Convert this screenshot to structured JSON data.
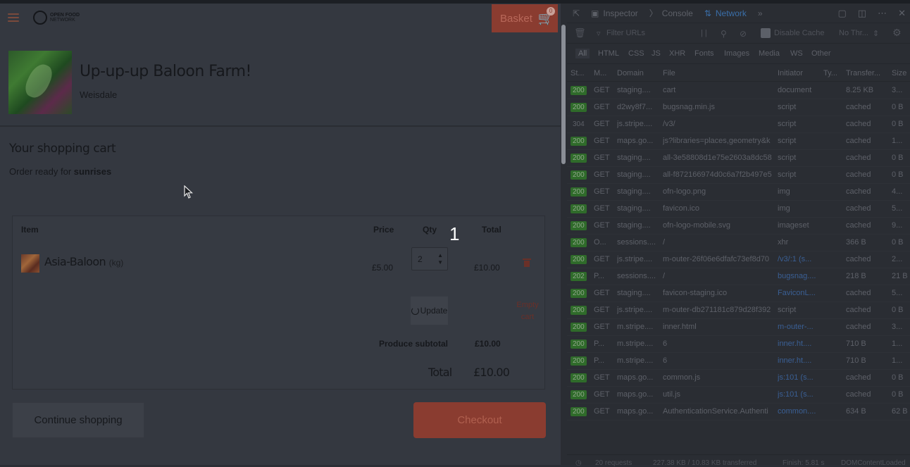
{
  "page": {
    "logo_top": "OPEN FOOD",
    "logo_bottom": "NETWORK",
    "basket_label": "Basket",
    "basket_count": "0",
    "farm_name": "Up-up-up Baloon Farm!",
    "farm_location": "Weisdale",
    "cart_title": "Your shopping cart",
    "order_prefix": "Order ready for ",
    "order_window": "sunrises",
    "table": {
      "headers": {
        "item": "Item",
        "price": "Price",
        "qty": "Qty",
        "total": "Total"
      },
      "row": {
        "name": "Asia-Baloon",
        "unit": "(kg)",
        "price": "£5.00",
        "qty": "2",
        "total": "£10.00"
      }
    },
    "update_label": "Update",
    "empty_cart_label": "Empty cart",
    "produce_subtotal_label": "Produce subtotal",
    "produce_subtotal_value": "£10.00",
    "total_label": "Total",
    "total_value": "£10.00",
    "continue_label": "Continue shopping",
    "checkout_label": "Checkout",
    "overlay_number": "1"
  },
  "devtools": {
    "tabs": [
      "Inspector",
      "Console",
      "Network"
    ],
    "active_tab": "Network",
    "filter_placeholder": "Filter URLs",
    "disable_cache": "Disable Cache",
    "throttle": "No Thr...",
    "types": [
      "All",
      "HTML",
      "CSS",
      "JS",
      "XHR",
      "Fonts",
      "Images",
      "Media",
      "WS",
      "Other"
    ],
    "columns": [
      "St...",
      "M...",
      "Domain",
      "File",
      "Initiator",
      "Ty...",
      "Transfer...",
      "Size"
    ],
    "requests": [
      {
        "status": "200",
        "method": "GET",
        "domain": "staging....",
        "file": "cart",
        "initiator": "document",
        "initiator_link": false,
        "transferred": "8.25 KB",
        "size": "3..."
      },
      {
        "status": "200",
        "method": "GET",
        "domain": "d2wy8f7...",
        "file": "bugsnag.min.js",
        "initiator": "script",
        "initiator_link": false,
        "transferred": "cached",
        "size": "0 B"
      },
      {
        "status": "304",
        "method": "GET",
        "domain": "js.stripe....",
        "file": "/v3/",
        "initiator": "script",
        "initiator_link": false,
        "transferred": "cached",
        "size": "0 B"
      },
      {
        "status": "200",
        "method": "GET",
        "domain": "maps.go...",
        "file": "js?libraries=places,geometry&k",
        "initiator": "script",
        "initiator_link": false,
        "transferred": "cached",
        "size": "1..."
      },
      {
        "status": "200",
        "method": "GET",
        "domain": "staging....",
        "file": "all-3e58808d1e75e2603a8dc58",
        "initiator": "script",
        "initiator_link": false,
        "transferred": "cached",
        "size": "0 B"
      },
      {
        "status": "200",
        "method": "GET",
        "domain": "staging....",
        "file": "all-f872166974d0c6a7f2b497e5",
        "initiator": "script",
        "initiator_link": false,
        "transferred": "cached",
        "size": "0 B"
      },
      {
        "status": "200",
        "method": "GET",
        "domain": "staging....",
        "file": "ofn-logo.png",
        "initiator": "img",
        "initiator_link": false,
        "transferred": "cached",
        "size": "4..."
      },
      {
        "status": "200",
        "method": "GET",
        "domain": "staging....",
        "file": "favicon.ico",
        "initiator": "img",
        "initiator_link": false,
        "transferred": "cached",
        "size": "5..."
      },
      {
        "status": "200",
        "method": "GET",
        "domain": "staging....",
        "file": "ofn-logo-mobile.svg",
        "initiator": "imageset",
        "initiator_link": false,
        "transferred": "cached",
        "size": "9..."
      },
      {
        "status": "200",
        "method": "O...",
        "domain": "sessions....",
        "file": "/",
        "initiator": "xhr",
        "initiator_link": false,
        "transferred": "366 B",
        "size": "0 B"
      },
      {
        "status": "200",
        "method": "GET",
        "domain": "js.stripe....",
        "file": "m-outer-26f06e6dfafc73ef8d70",
        "initiator": "/v3/:1 (s...",
        "initiator_link": true,
        "transferred": "cached",
        "size": "2..."
      },
      {
        "status": "202",
        "method": "P...",
        "domain": "sessions....",
        "file": "/",
        "initiator": "bugsnag....",
        "initiator_link": true,
        "transferred": "218 B",
        "size": "21 B"
      },
      {
        "status": "200",
        "method": "GET",
        "domain": "staging....",
        "file": "favicon-staging.ico",
        "initiator": "FaviconL...",
        "initiator_link": true,
        "transferred": "cached",
        "size": "5..."
      },
      {
        "status": "200",
        "method": "GET",
        "domain": "js.stripe....",
        "file": "m-outer-db271181c879d28f392",
        "initiator": "script",
        "initiator_link": false,
        "transferred": "cached",
        "size": "0 B"
      },
      {
        "status": "200",
        "method": "GET",
        "domain": "m.stripe....",
        "file": "inner.html",
        "initiator": "m-outer-...",
        "initiator_link": true,
        "transferred": "cached",
        "size": "3..."
      },
      {
        "status": "200",
        "method": "P...",
        "domain": "m.stripe....",
        "file": "6",
        "initiator": "inner.ht....",
        "initiator_link": true,
        "transferred": "710 B",
        "size": "1..."
      },
      {
        "status": "200",
        "method": "P...",
        "domain": "m.stripe....",
        "file": "6",
        "initiator": "inner.ht....",
        "initiator_link": true,
        "transferred": "710 B",
        "size": "1..."
      },
      {
        "status": "200",
        "method": "GET",
        "domain": "maps.go...",
        "file": "common.js",
        "initiator": "js:101 (s...",
        "initiator_link": true,
        "transferred": "cached",
        "size": "0 B"
      },
      {
        "status": "200",
        "method": "GET",
        "domain": "maps.go...",
        "file": "util.js",
        "initiator": "js:101 (s...",
        "initiator_link": true,
        "transferred": "cached",
        "size": "0 B"
      },
      {
        "status": "200",
        "method": "GET",
        "domain": "maps.go...",
        "file": "AuthenticationService.Authenti",
        "initiator": "common....",
        "initiator_link": true,
        "transferred": "634 B",
        "size": "62 B"
      }
    ],
    "footer": {
      "requests": "20 requests",
      "transferred": "227.38 KB / 10.83 KB transferred",
      "finish": "Finish: 5.81 s",
      "dom": "DOMContentLoaded"
    }
  }
}
